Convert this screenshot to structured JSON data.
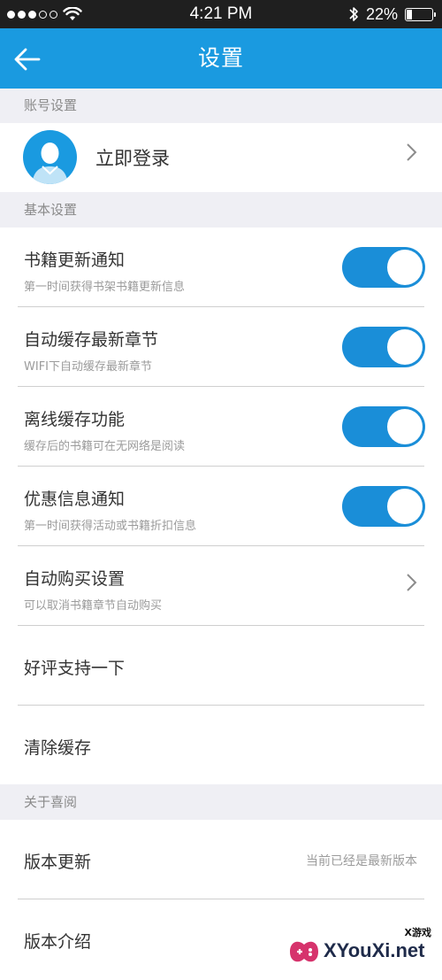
{
  "status_bar": {
    "time": "4:21 PM",
    "battery_percent": "22%",
    "battery_level": 0.22,
    "signal_icon": "signal-dots-icon",
    "wifi_icon": "wifi-icon",
    "bluetooth_icon": "bluetooth-icon"
  },
  "navbar": {
    "title": "设置",
    "back_icon": "back-arrow-icon"
  },
  "sections": {
    "account": "账号设置",
    "basic": "基本设置",
    "about": "关于喜阅"
  },
  "account": {
    "login_label": "立即登录"
  },
  "settings": {
    "book_update": {
      "title": "书籍更新通知",
      "subtitle": "第一时间获得书架书籍更新信息",
      "enabled": true
    },
    "auto_cache": {
      "title": "自动缓存最新章节",
      "subtitle": "WIFI下自动缓存最新章节",
      "enabled": true
    },
    "offline_cache": {
      "title": "离线缓存功能",
      "subtitle": "缓存后的书籍可在无网络是阅读",
      "enabled": true
    },
    "promo_notify": {
      "title": "优惠信息通知",
      "subtitle": "第一时间获得活动或书籍折扣信息",
      "enabled": true
    },
    "auto_buy": {
      "title": "自动购买设置",
      "subtitle": "可以取消书籍章节自动购买"
    },
    "rate": {
      "title": "好评支持一下"
    },
    "clear_cache": {
      "title": "清除缓存"
    }
  },
  "about": {
    "version_update": {
      "title": "版本更新",
      "value": "当前已经是最新版本"
    },
    "version_intro": {
      "title": "版本介绍"
    }
  },
  "watermark": {
    "text": "XYouXi.net",
    "small": "X游戏"
  },
  "colors": {
    "brand_blue": "#1a9ae0",
    "toggle_on": "#1a8ed8",
    "background": "#efeff4"
  }
}
